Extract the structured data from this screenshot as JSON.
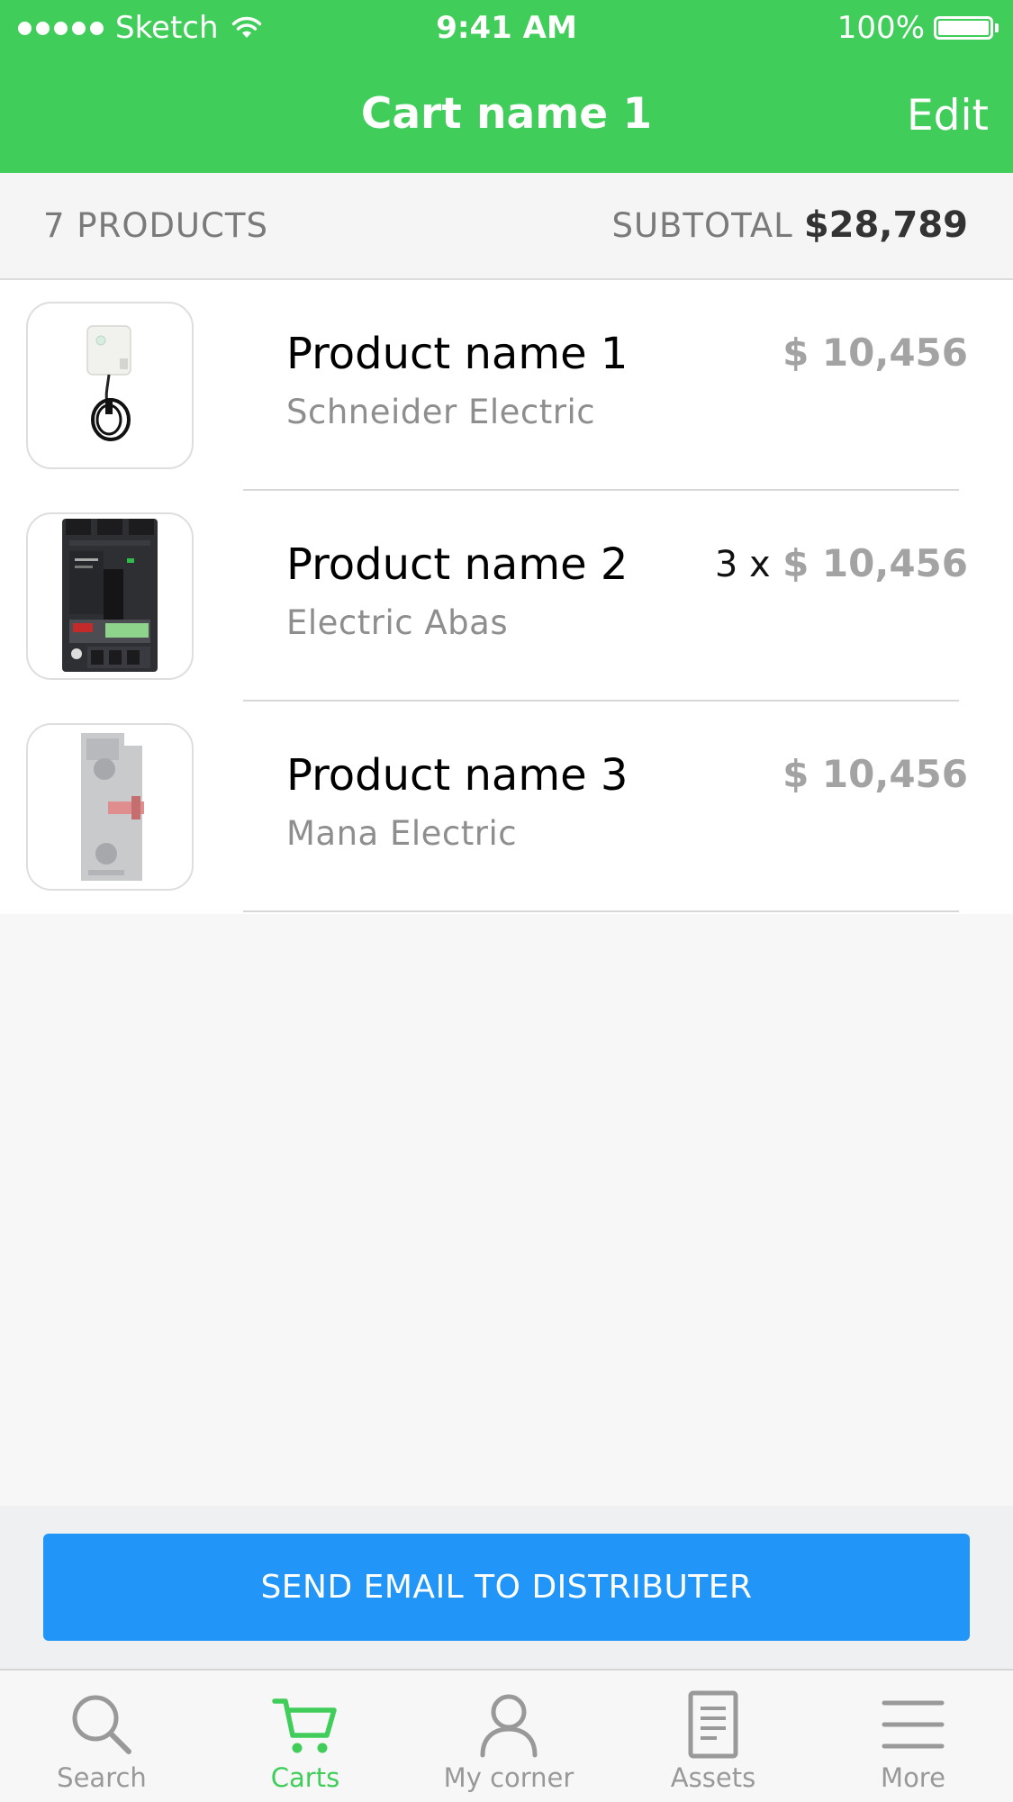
{
  "status_bar": {
    "carrier": "Sketch",
    "time": "9:41 AM",
    "battery": "100%"
  },
  "nav": {
    "title": "Cart name 1",
    "edit_label": "Edit"
  },
  "summary": {
    "count_label": "7 PRODUCTS",
    "subtotal_label": "SUBTOTAL",
    "subtotal_value": "$28,789"
  },
  "products": [
    {
      "name": "Product name 1",
      "brand": "Schneider Electric",
      "qty": "",
      "price": "$ 10,456",
      "thumb_icon": "wall-charger-icon"
    },
    {
      "name": "Product name 2",
      "brand": "Electric Abas",
      "qty": "3 x",
      "price": "$ 10,456",
      "thumb_icon": "circuit-breaker-icon"
    },
    {
      "name": "Product name 3",
      "brand": "Mana Electric",
      "qty": "",
      "price": "$ 10,456",
      "thumb_icon": "contact-block-icon"
    }
  ],
  "cta": {
    "label": "SEND EMAIL TO DISTRIBUTER"
  },
  "tabs": [
    {
      "label": "Search",
      "icon": "search-icon"
    },
    {
      "label": "Carts",
      "icon": "cart-icon",
      "active": true
    },
    {
      "label": "My corner",
      "icon": "person-icon"
    },
    {
      "label": "Assets",
      "icon": "document-icon"
    },
    {
      "label": "More",
      "icon": "menu-icon"
    }
  ],
  "colors": {
    "accent_green": "#40cd59",
    "button_blue": "#2196f8",
    "price_gray": "#a3a3a3"
  }
}
